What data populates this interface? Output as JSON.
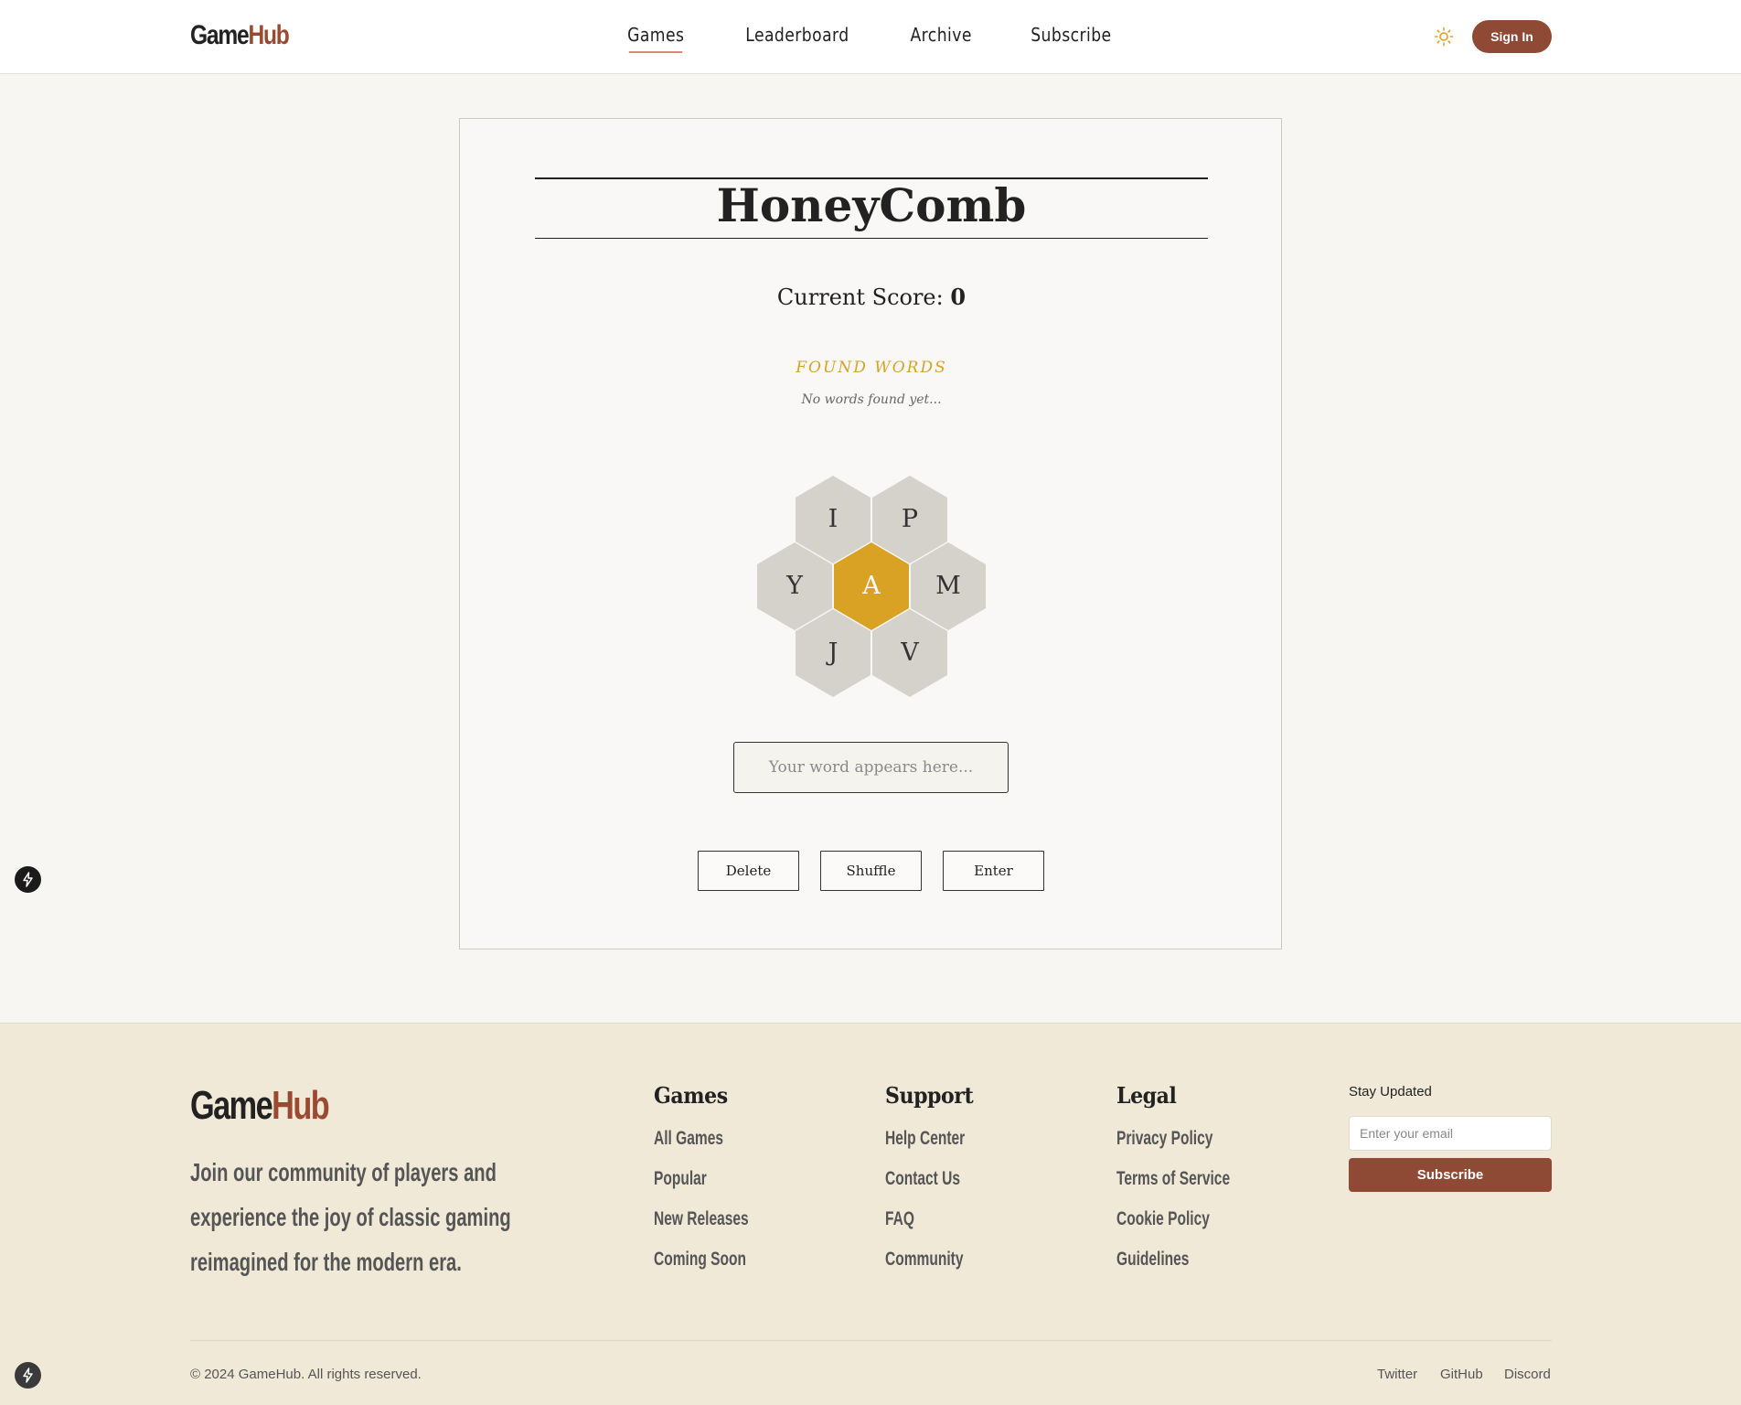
{
  "header": {
    "logo_game": "Game",
    "logo_hub": "Hub",
    "nav": [
      {
        "label": "Games",
        "active": true
      },
      {
        "label": "Leaderboard",
        "active": false
      },
      {
        "label": "Archive",
        "active": false
      },
      {
        "label": "Subscribe",
        "active": false
      }
    ],
    "theme_icon": "sun-icon",
    "signin_label": "Sign In"
  },
  "game": {
    "title": "HoneyComb",
    "score_label": "Current Score:",
    "score_value": "0",
    "found_words_title": "FOUND WORDS",
    "found_words_empty": "No words found yet...",
    "letters": {
      "center": "A",
      "top_left": "I",
      "top_right": "P",
      "left": "Y",
      "right": "M",
      "bottom_left": "J",
      "bottom_right": "V"
    },
    "word_placeholder": "Your word appears here...",
    "buttons": {
      "delete": "Delete",
      "shuffle": "Shuffle",
      "enter": "Enter"
    },
    "colors": {
      "center_hex": "#d9a224",
      "outer_hex": "#d5d1cb",
      "accent": "#8f4a36"
    }
  },
  "footer": {
    "logo_game": "Game",
    "logo_hub": "Hub",
    "description": "Join our community of players and experience the joy of classic gaming reimagined for the modern era.",
    "columns": [
      {
        "title": "Games",
        "links": [
          "All Games",
          "Popular",
          "New Releases",
          "Coming Soon"
        ]
      },
      {
        "title": "Support",
        "links": [
          "Help Center",
          "Contact Us",
          "FAQ",
          "Community"
        ]
      },
      {
        "title": "Legal",
        "links": [
          "Privacy Policy",
          "Terms of Service",
          "Cookie Policy",
          "Guidelines"
        ]
      }
    ],
    "newsletter": {
      "title": "Stay Updated",
      "placeholder": "Enter your email",
      "button": "Subscribe"
    },
    "copyright": "© 2024 GameHub. All rights reserved.",
    "social": [
      "Twitter",
      "GitHub",
      "Discord"
    ]
  },
  "floating_icons": [
    "bolt-icon",
    "bolt-icon"
  ]
}
